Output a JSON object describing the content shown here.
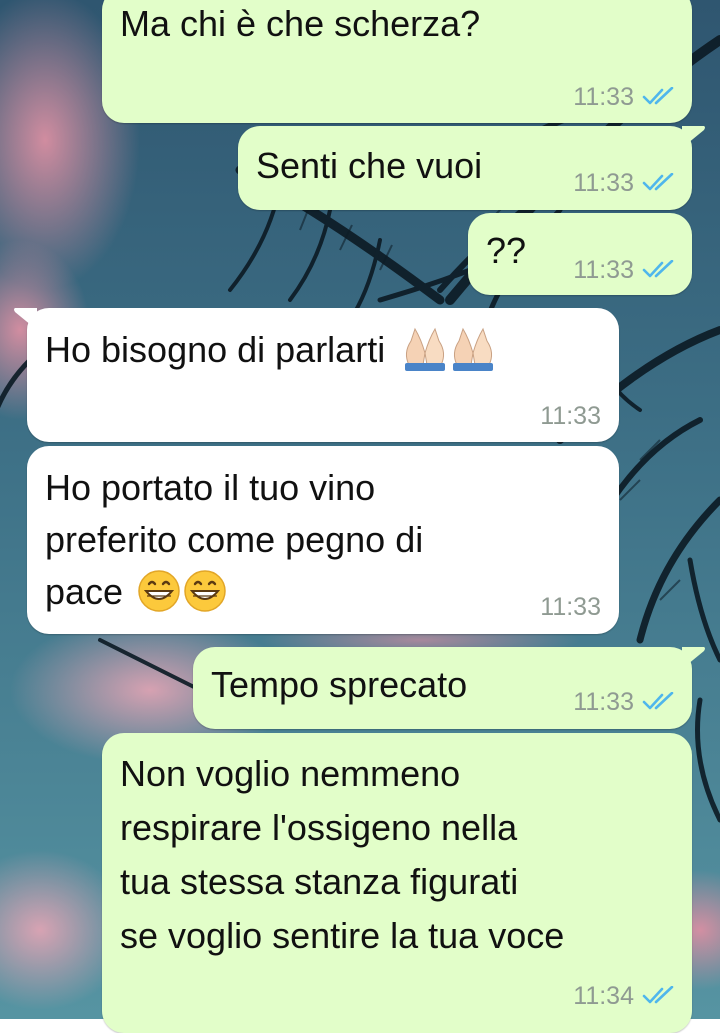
{
  "chat": {
    "messages": [
      {
        "direction": "outgoing",
        "lines": [
          "Ma chi è che scherza?"
        ],
        "time": "11:33",
        "status": "read"
      },
      {
        "direction": "outgoing",
        "lines": [
          "Senti che vuoi"
        ],
        "time": "11:33",
        "status": "read"
      },
      {
        "direction": "outgoing",
        "lines": [
          "??"
        ],
        "time": "11:33",
        "status": "read"
      },
      {
        "direction": "incoming",
        "lines": [
          "Ho bisogno di parlarti"
        ],
        "emoji": [
          "folded-hands",
          "folded-hands"
        ],
        "time": "11:33"
      },
      {
        "direction": "incoming",
        "lines": [
          "Ho portato il tuo vino",
          "preferito come pegno di",
          "pace"
        ],
        "emoji": [
          "grinning-face",
          "grinning-face"
        ],
        "time": "11:33"
      },
      {
        "direction": "outgoing",
        "lines": [
          "Tempo sprecato"
        ],
        "time": "11:33",
        "status": "read"
      },
      {
        "direction": "outgoing",
        "lines": [
          "Non voglio nemmeno",
          "respirare l'ossigeno nella",
          "tua stessa stanza figurati",
          "se voglio sentire la tua voce"
        ],
        "time": "11:34",
        "status": "read"
      }
    ]
  },
  "colors": {
    "outgoing_bubble": "#e2fec9",
    "incoming_bubble": "#ffffff",
    "read_ticks": "#4fb6ec",
    "timestamp": "#8f9a92"
  }
}
